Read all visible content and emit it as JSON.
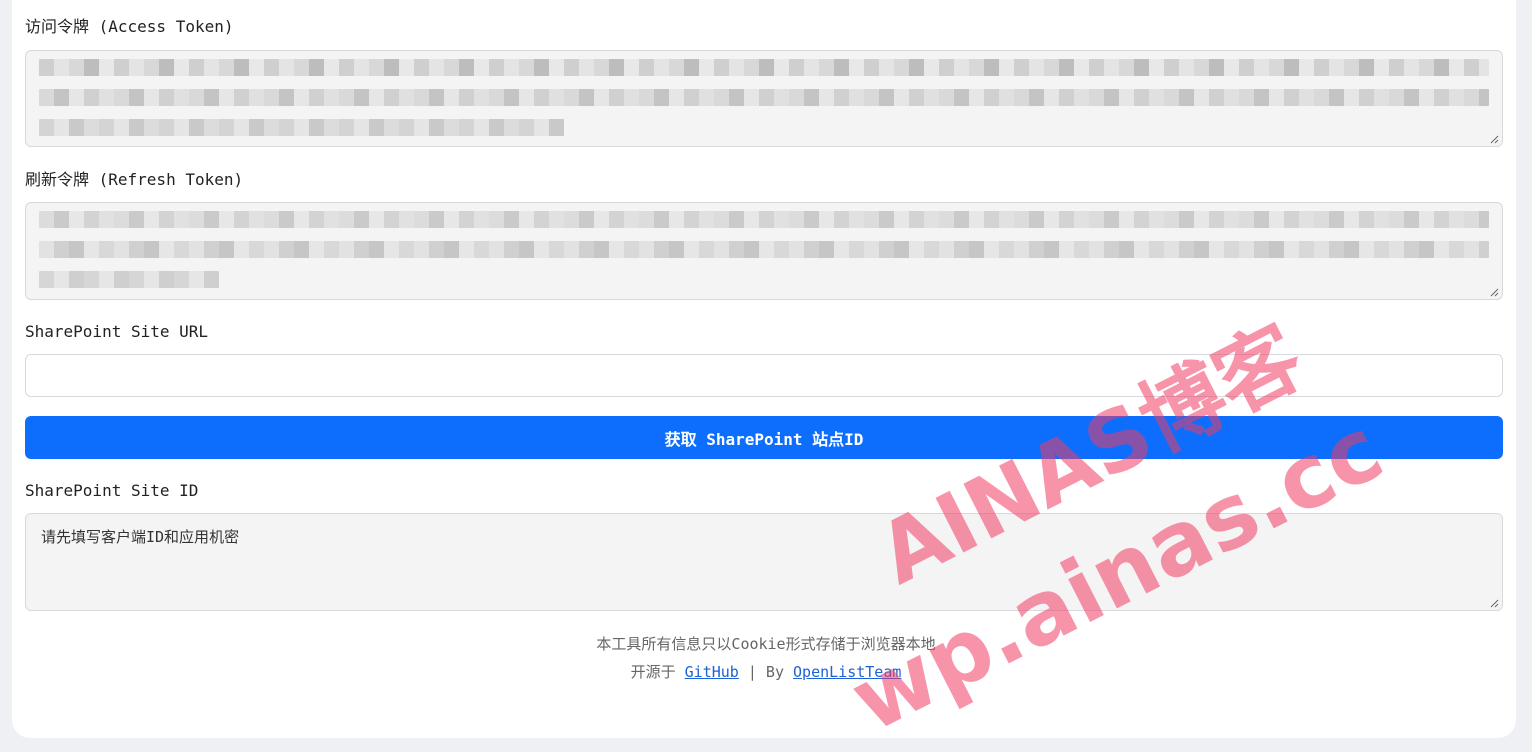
{
  "access_token": {
    "label": "访问令牌 (Access Token)"
  },
  "refresh_token": {
    "label": "刷新令牌 (Refresh Token)"
  },
  "site_url": {
    "label": "SharePoint Site URL",
    "value": "",
    "placeholder": ""
  },
  "get_site_id_button": {
    "label": "获取 SharePoint 站点ID"
  },
  "site_id": {
    "label": "SharePoint Site ID",
    "value": "请先填写客户端ID和应用机密"
  },
  "footer": {
    "notice": "本工具所有信息只以Cookie形式存储于浏览器本地",
    "open_source_prefix": "开源于",
    "github_link": "GitHub",
    "separator": "| By",
    "team_link": "OpenListTeam"
  },
  "watermark": {
    "line1": "AINAS博客",
    "line2": "wp.ainas.cc"
  },
  "colors": {
    "primary": "#0d6efd",
    "watermark": "#f03c64"
  }
}
